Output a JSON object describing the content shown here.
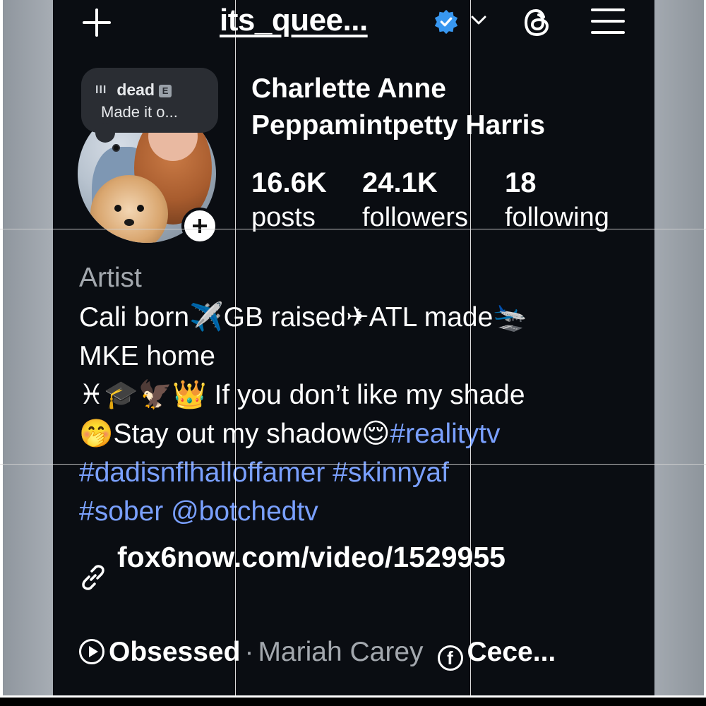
{
  "header": {
    "username": "its_quee...",
    "new_post_icon": "plus-icon",
    "verified_icon": "verified-badge-icon",
    "account_switch_icon": "chevron-down-icon",
    "threads_icon": "threads-icon",
    "menu_icon": "hamburger-menu-icon"
  },
  "note": {
    "song_title": "dead",
    "explicit": "E",
    "text": "Made it o..."
  },
  "profile": {
    "display_name": "Charlette Anne Peppamintpetty Harris",
    "stats": [
      {
        "value": "16.6K",
        "label": "posts"
      },
      {
        "value": "24.1K",
        "label": "followers"
      },
      {
        "value": "18",
        "label": "following"
      }
    ],
    "category": "Artist",
    "bio": {
      "line1": "Cali born✈️GB raised✈ATL made🛬",
      "line2": "MKE home",
      "line3": "♓🎓🦅👑 If you don’t like my shade",
      "line4_text": "🤭Stay out my shadow😌",
      "line4_tag": "#realitytv",
      "line5": "#dadisnflhalloffamer #skinnyaf",
      "line6": "#sober @botchedtv"
    },
    "link": "fox6now.com/video/1529955"
  },
  "music": {
    "song": "Obsessed",
    "separator": "·",
    "artist": "Mariah Carey",
    "facebook_name": "Cece..."
  },
  "colors": {
    "background": "#0a0d12",
    "text": "#ffffff",
    "muted": "#a3a8ae",
    "hashtag": "#7aa0ff",
    "verified": "#3897f0"
  }
}
